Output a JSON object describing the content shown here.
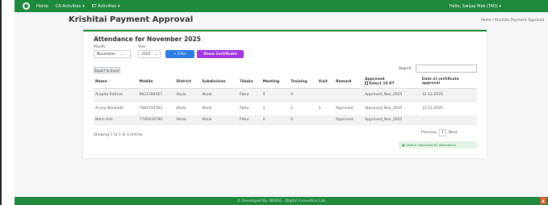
{
  "topbar": {
    "nav": [
      {
        "label": "Home",
        "caret": ""
      },
      {
        "label": "CA Activities",
        "caret": "▾"
      },
      {
        "label": "KT Activities",
        "caret": "▾"
      }
    ],
    "user": "Hello, Sanjay Mak (TAO)",
    "user_caret": "▾"
  },
  "page": {
    "title": "Krishitai Payment Approval",
    "breadcrumb": "Home / Krishitai Payment Approval"
  },
  "card": {
    "title": "Attendance for November 2025",
    "month_label": "Month",
    "month_value": "November",
    "year_label": "Year",
    "year_value": "2025",
    "filter_label": "+ Filter",
    "cert_label": "Show Certificate",
    "export_label": "Export to Excel",
    "search_label": "Search:"
  },
  "table": {
    "headers": [
      "Name",
      "Mobile",
      "District",
      "Subdivision",
      "Taluka",
      "Meeting",
      "Training",
      "Visit",
      "Remark",
      "Approved",
      "Date of certificate"
    ],
    "header_sub": {
      "approved": "Select 10 KT",
      "date": "approval"
    },
    "rows": [
      {
        "name": "Arapita Rathod",
        "mobile": "9921594567",
        "district": "Akola",
        "subdivision": "Akola",
        "taluka": "Patur",
        "meeting": "0",
        "training": "0",
        "visit": "",
        "remark": "",
        "approved": "Approved_Nov_2025",
        "date": "12-12-2025"
      },
      {
        "name": "Aruna Narwade",
        "mobile": "7083744782",
        "district": "Akola",
        "subdivision": "Akola",
        "taluka": "Patur",
        "meeting": "1",
        "training": "1",
        "visit": "1",
        "remark": "Approved",
        "approved": "Approved_Nov_2025",
        "date": "12-12-2025"
      },
      {
        "name": "Neha Ade",
        "mobile": "7720416790",
        "district": "Akola",
        "subdivision": "Akola",
        "taluka": "Patur",
        "meeting": "0",
        "training": "0",
        "visit": "",
        "remark": "Approved",
        "approved": "Approved_Nov_2025",
        "date": "-"
      }
    ]
  },
  "entries": "Showing 1 to 3 of 3 entries",
  "pager": {
    "prev": "Previous",
    "page": "1",
    "next": "Next"
  },
  "status": "Status: Approved KT attendance",
  "footer": "© Developed By: NDKSE - Digital Innovation Lab",
  "colors": {
    "brand": "#1f8a3c",
    "filter": "#2d7be5",
    "cert": "#a238e0"
  }
}
